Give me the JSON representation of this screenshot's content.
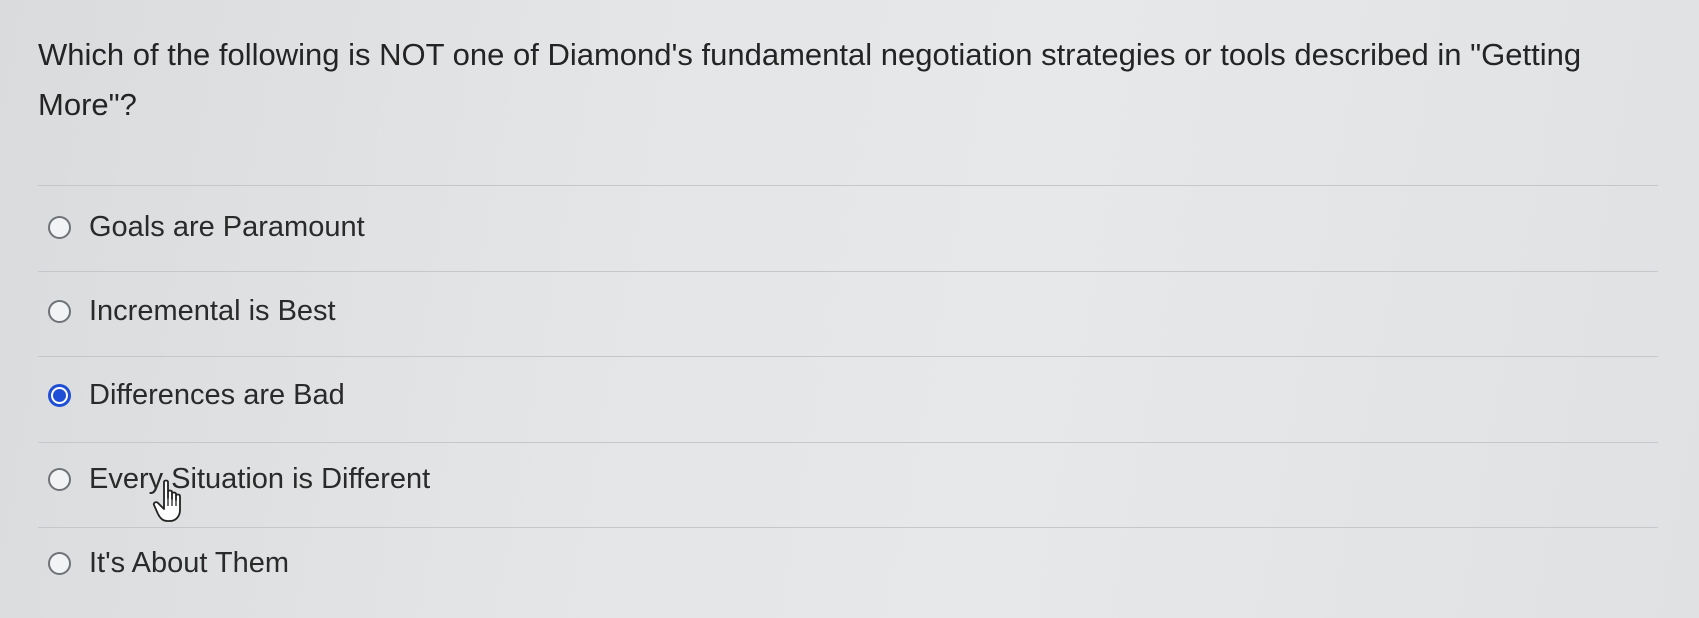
{
  "question": {
    "text": "Which of the following is NOT one of Diamond's fundamental negotiation strategies or tools described in \"Getting More\"?"
  },
  "options": [
    {
      "label": "Goals are Paramount",
      "selected": false
    },
    {
      "label": "Incremental is Best",
      "selected": false
    },
    {
      "label": "Differences are Bad",
      "selected": true
    },
    {
      "label": "Every Situation is Different",
      "selected": false
    },
    {
      "label": "It's About Them",
      "selected": false
    }
  ],
  "colors": {
    "accent": "#1f4fd6",
    "text": "#2a2a2a",
    "divider": "#c4c7cb"
  },
  "cursor": {
    "icon": "hand-pointer-icon"
  }
}
